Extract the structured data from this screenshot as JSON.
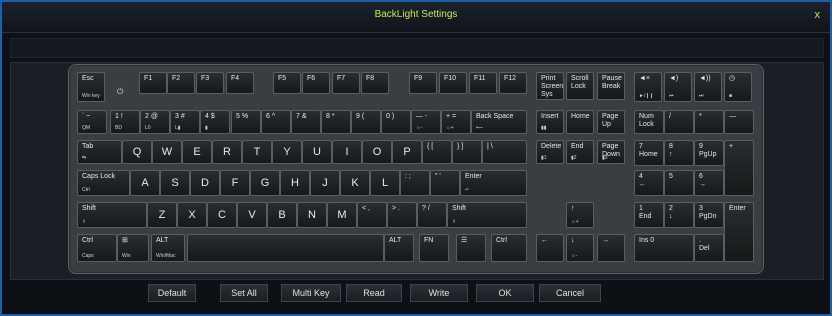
{
  "window": {
    "title": "BackLight Settings",
    "close_label": "x"
  },
  "keyboard": {
    "power_symbol": "⏻",
    "keys": [
      {
        "n": "esc",
        "l": "Esc",
        "s": "Win key"
      },
      {
        "n": "f1",
        "l": "F1"
      },
      {
        "n": "f2",
        "l": "F2"
      },
      {
        "n": "f3",
        "l": "F3"
      },
      {
        "n": "f4",
        "l": "F4"
      },
      {
        "n": "f5",
        "l": "F5"
      },
      {
        "n": "f6",
        "l": "F6"
      },
      {
        "n": "f7",
        "l": "F7"
      },
      {
        "n": "f8",
        "l": "F8"
      },
      {
        "n": "f9",
        "l": "F9"
      },
      {
        "n": "f10",
        "l": "F10"
      },
      {
        "n": "f11",
        "l": "F11"
      },
      {
        "n": "f12",
        "l": "F12"
      },
      {
        "n": "print-screen",
        "l": "Print\nScreen\nSys Rq"
      },
      {
        "n": "scroll-lock",
        "l": "Scroll\nLock"
      },
      {
        "n": "pause-break",
        "l": "Pause\nBreak"
      },
      {
        "n": "mute",
        "l": "◄×",
        "s": "►/❙❙"
      },
      {
        "n": "vol-down",
        "l": "◄)",
        "s": "⏮"
      },
      {
        "n": "vol-up",
        "l": "◄))",
        "s": "⏭"
      },
      {
        "n": "calc",
        "l": "◷",
        "s": "■"
      },
      {
        "n": "backtick",
        "l": "` ~",
        "s": "QM"
      },
      {
        "n": "1",
        "l": "1 !",
        "s": "BD"
      },
      {
        "n": "2",
        "l": "2 @",
        "s": "L0"
      },
      {
        "n": "3",
        "l": "3 #",
        "s": "L▮"
      },
      {
        "n": "4",
        "l": "4 $",
        "s": "▮"
      },
      {
        "n": "5",
        "l": "5 %"
      },
      {
        "n": "6",
        "l": "6 ^"
      },
      {
        "n": "7",
        "l": "7 &"
      },
      {
        "n": "8",
        "l": "8 *"
      },
      {
        "n": "9",
        "l": "9 ("
      },
      {
        "n": "0",
        "l": "0 )"
      },
      {
        "n": "minus",
        "l": "— -",
        "s": "☼-"
      },
      {
        "n": "equals",
        "l": "+ =",
        "s": "☼+"
      },
      {
        "n": "backspace",
        "l": "Back Space",
        "s": "⟵"
      },
      {
        "n": "insert",
        "l": "Insert",
        "s": "▮▮"
      },
      {
        "n": "home",
        "l": "Home"
      },
      {
        "n": "page-up",
        "l": "Page\nUp"
      },
      {
        "n": "num-lock",
        "l": "Num\nLock"
      },
      {
        "n": "num-slash",
        "l": "/"
      },
      {
        "n": "num-star",
        "l": "*"
      },
      {
        "n": "num-minus",
        "l": "—"
      },
      {
        "n": "tab",
        "l": "Tab",
        "s": "⇆"
      },
      {
        "n": "q",
        "l": "Q"
      },
      {
        "n": "w",
        "l": "W"
      },
      {
        "n": "e",
        "l": "E"
      },
      {
        "n": "r",
        "l": "R"
      },
      {
        "n": "t",
        "l": "T"
      },
      {
        "n": "y",
        "l": "Y"
      },
      {
        "n": "u",
        "l": "U"
      },
      {
        "n": "i",
        "l": "I"
      },
      {
        "n": "o",
        "l": "O"
      },
      {
        "n": "p",
        "l": "P"
      },
      {
        "n": "lbracket",
        "l": "{ ["
      },
      {
        "n": "rbracket",
        "l": "} ]"
      },
      {
        "n": "backslash",
        "l": "| \\"
      },
      {
        "n": "delete",
        "l": "Delete",
        "s": "▮1"
      },
      {
        "n": "end",
        "l": "End",
        "s": "▮2"
      },
      {
        "n": "page-down",
        "l": "Page\nDown",
        "s": "▮3"
      },
      {
        "n": "num-7",
        "l": "7\nHome"
      },
      {
        "n": "num-8",
        "l": "8\n↑"
      },
      {
        "n": "num-9",
        "l": "9\nPgUp"
      },
      {
        "n": "num-plus",
        "l": "+"
      },
      {
        "n": "caps-lock",
        "l": "Caps Lock",
        "s": "Ctrl"
      },
      {
        "n": "a",
        "l": "A"
      },
      {
        "n": "s",
        "l": "S"
      },
      {
        "n": "d",
        "l": "D"
      },
      {
        "n": "f",
        "l": "F"
      },
      {
        "n": "g",
        "l": "G"
      },
      {
        "n": "h",
        "l": "H"
      },
      {
        "n": "j",
        "l": "J"
      },
      {
        "n": "k",
        "l": "K"
      },
      {
        "n": "l",
        "l": "L"
      },
      {
        "n": "semicolon",
        "l": ": ;"
      },
      {
        "n": "quote",
        "l": "\" '"
      },
      {
        "n": "enter",
        "l": "Enter",
        "s": "↵"
      },
      {
        "n": "num-4",
        "l": "4\n←"
      },
      {
        "n": "num-5",
        "l": "5"
      },
      {
        "n": "num-6",
        "l": "6\n→"
      },
      {
        "n": "lshift",
        "l": "Shift",
        "s": "⇧"
      },
      {
        "n": "z",
        "l": "Z"
      },
      {
        "n": "x",
        "l": "X"
      },
      {
        "n": "c",
        "l": "C"
      },
      {
        "n": "v",
        "l": "V"
      },
      {
        "n": "b",
        "l": "B"
      },
      {
        "n": "n",
        "l": "N"
      },
      {
        "n": "m",
        "l": "M"
      },
      {
        "n": "comma",
        "l": "< ,"
      },
      {
        "n": "period",
        "l": "> ."
      },
      {
        "n": "slash",
        "l": "? /"
      },
      {
        "n": "rshift",
        "l": "Shift",
        "s": "⇧"
      },
      {
        "n": "arrow-up",
        "l": "↑",
        "s": "☼+"
      },
      {
        "n": "num-1",
        "l": "1\nEnd"
      },
      {
        "n": "num-2",
        "l": "2\n↓"
      },
      {
        "n": "num-3",
        "l": "3\nPgDn"
      },
      {
        "n": "num-enter",
        "l": "Enter"
      },
      {
        "n": "lctrl",
        "l": "Ctrl",
        "s": "Caps"
      },
      {
        "n": "lwin",
        "l": "⊞",
        "s": "Win"
      },
      {
        "n": "lalt",
        "l": "ALT",
        "s": "Win/Mac"
      },
      {
        "n": "space",
        "l": ""
      },
      {
        "n": "ralt",
        "l": "ALT"
      },
      {
        "n": "fn",
        "l": "FN"
      },
      {
        "n": "menu",
        "l": "☰"
      },
      {
        "n": "rctrl",
        "l": "Ctrl"
      },
      {
        "n": "arrow-left",
        "l": "←"
      },
      {
        "n": "arrow-down",
        "l": "↓",
        "s": "☼-"
      },
      {
        "n": "arrow-right",
        "l": "→"
      },
      {
        "n": "num-0",
        "l": "Ins      0"
      },
      {
        "n": "num-dot",
        "l": ".\nDel"
      }
    ]
  },
  "buttons": [
    "Default",
    "Set All",
    "Multi Key",
    "Read",
    "Write",
    "OK",
    "Cancel"
  ]
}
